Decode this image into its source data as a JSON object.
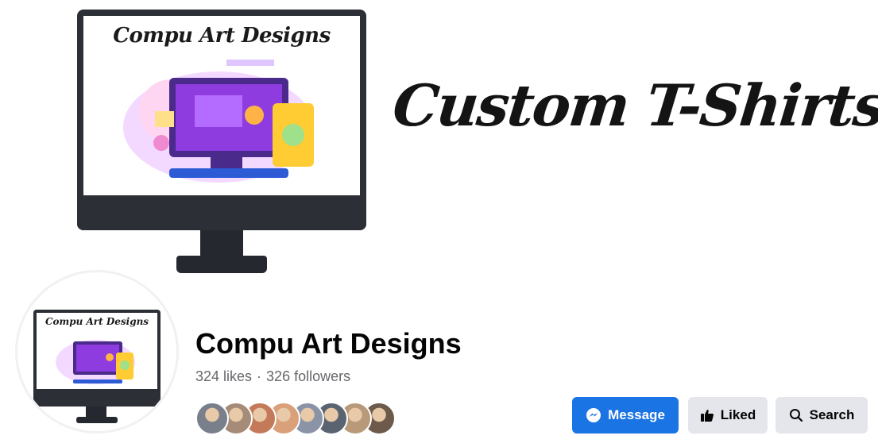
{
  "cover": {
    "monitor_title": "Compu Art Designs",
    "tagline": "Custom T-Shirts"
  },
  "profile": {
    "picture_title": "Compu Art Designs",
    "name": "Compu Art Designs",
    "likes": "324 likes",
    "separator": "·",
    "followers": "326 followers",
    "friend_avatar_colors": [
      "#7a7f8c",
      "#a68c78",
      "#c47a5a",
      "#d9a07a",
      "#8a94a6",
      "#5a6470",
      "#b89a7a",
      "#6e5a4a"
    ]
  },
  "actions": {
    "message_label": "Message",
    "liked_label": "Liked",
    "search_label": "Search"
  },
  "colors": {
    "primary_blue": "#1b74e4",
    "secondary_button": "#e4e6eb",
    "accent_purple": "#8e3be0"
  }
}
